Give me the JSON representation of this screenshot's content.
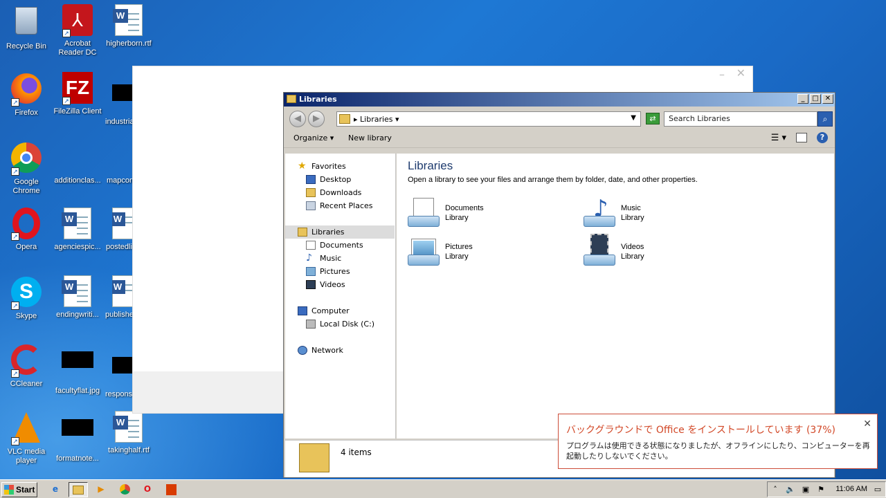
{
  "desktop": {
    "icons": [
      {
        "label": "Recycle Bin",
        "icon": "recycle-bin-icon"
      },
      {
        "label": "Acrobat Reader DC",
        "icon": "acrobat-icon"
      },
      {
        "label": "higherborn.rtf",
        "icon": "word-doc-icon"
      },
      {
        "label": "Firefox",
        "icon": "firefox-icon"
      },
      {
        "label": "FileZilla Client",
        "icon": "filezilla-icon"
      },
      {
        "label": "industria",
        "icon": "black-thumb-icon"
      },
      {
        "label": "Google Chrome",
        "icon": "chrome-icon"
      },
      {
        "label": "additionclas...",
        "icon": "blank-file-icon"
      },
      {
        "label": "mapcom",
        "icon": "blank-file-icon"
      },
      {
        "label": "Opera",
        "icon": "opera-icon"
      },
      {
        "label": "agenciespic...",
        "icon": "word-doc-icon"
      },
      {
        "label": "postedli",
        "icon": "word-doc-icon"
      },
      {
        "label": "Skype",
        "icon": "skype-icon"
      },
      {
        "label": "endingwriti...",
        "icon": "word-doc-icon"
      },
      {
        "label": "publishe",
        "icon": "word-doc-icon"
      },
      {
        "label": "CCleaner",
        "icon": "ccleaner-icon"
      },
      {
        "label": "facultyflat.jpg",
        "icon": "black-thumb-icon"
      },
      {
        "label": "respons",
        "icon": "black-thumb-icon"
      },
      {
        "label": "VLC media player",
        "icon": "vlc-icon"
      },
      {
        "label": "formatnote...",
        "icon": "black-thumb-icon"
      },
      {
        "label": "takinghalf.rtf",
        "icon": "word-doc-icon"
      }
    ]
  },
  "explorer": {
    "title": "Libraries",
    "address": "Libraries",
    "search_placeholder": "Search Libraries",
    "toolbar": {
      "organize": "Organize",
      "new_library": "New library"
    },
    "nav": {
      "favorites": "Favorites",
      "desktop": "Desktop",
      "downloads": "Downloads",
      "recent": "Recent Places",
      "libraries": "Libraries",
      "documents": "Documents",
      "music": "Music",
      "pictures": "Pictures",
      "videos": "Videos",
      "computer": "Computer",
      "local_disk": "Local Disk (C:)",
      "network": "Network"
    },
    "heading": "Libraries",
    "subheading": "Open a library to see your files and arrange them by folder, date, and other properties.",
    "libraries": [
      {
        "name": "Documents",
        "type": "Library"
      },
      {
        "name": "Music",
        "type": "Library"
      },
      {
        "name": "Pictures",
        "type": "Library"
      },
      {
        "name": "Videos",
        "type": "Library"
      }
    ],
    "status": "4 items"
  },
  "notification": {
    "title": "バックグラウンドで Office をインストールしています (37%)",
    "body": "プログラムは使用できる状態になりましたが、オフラインにしたり、コンピューターを再起動したりしないでください。",
    "progress_percent": 37,
    "accent": "#d24726"
  },
  "taskbar": {
    "start": "Start",
    "clock": "11:06 AM"
  }
}
